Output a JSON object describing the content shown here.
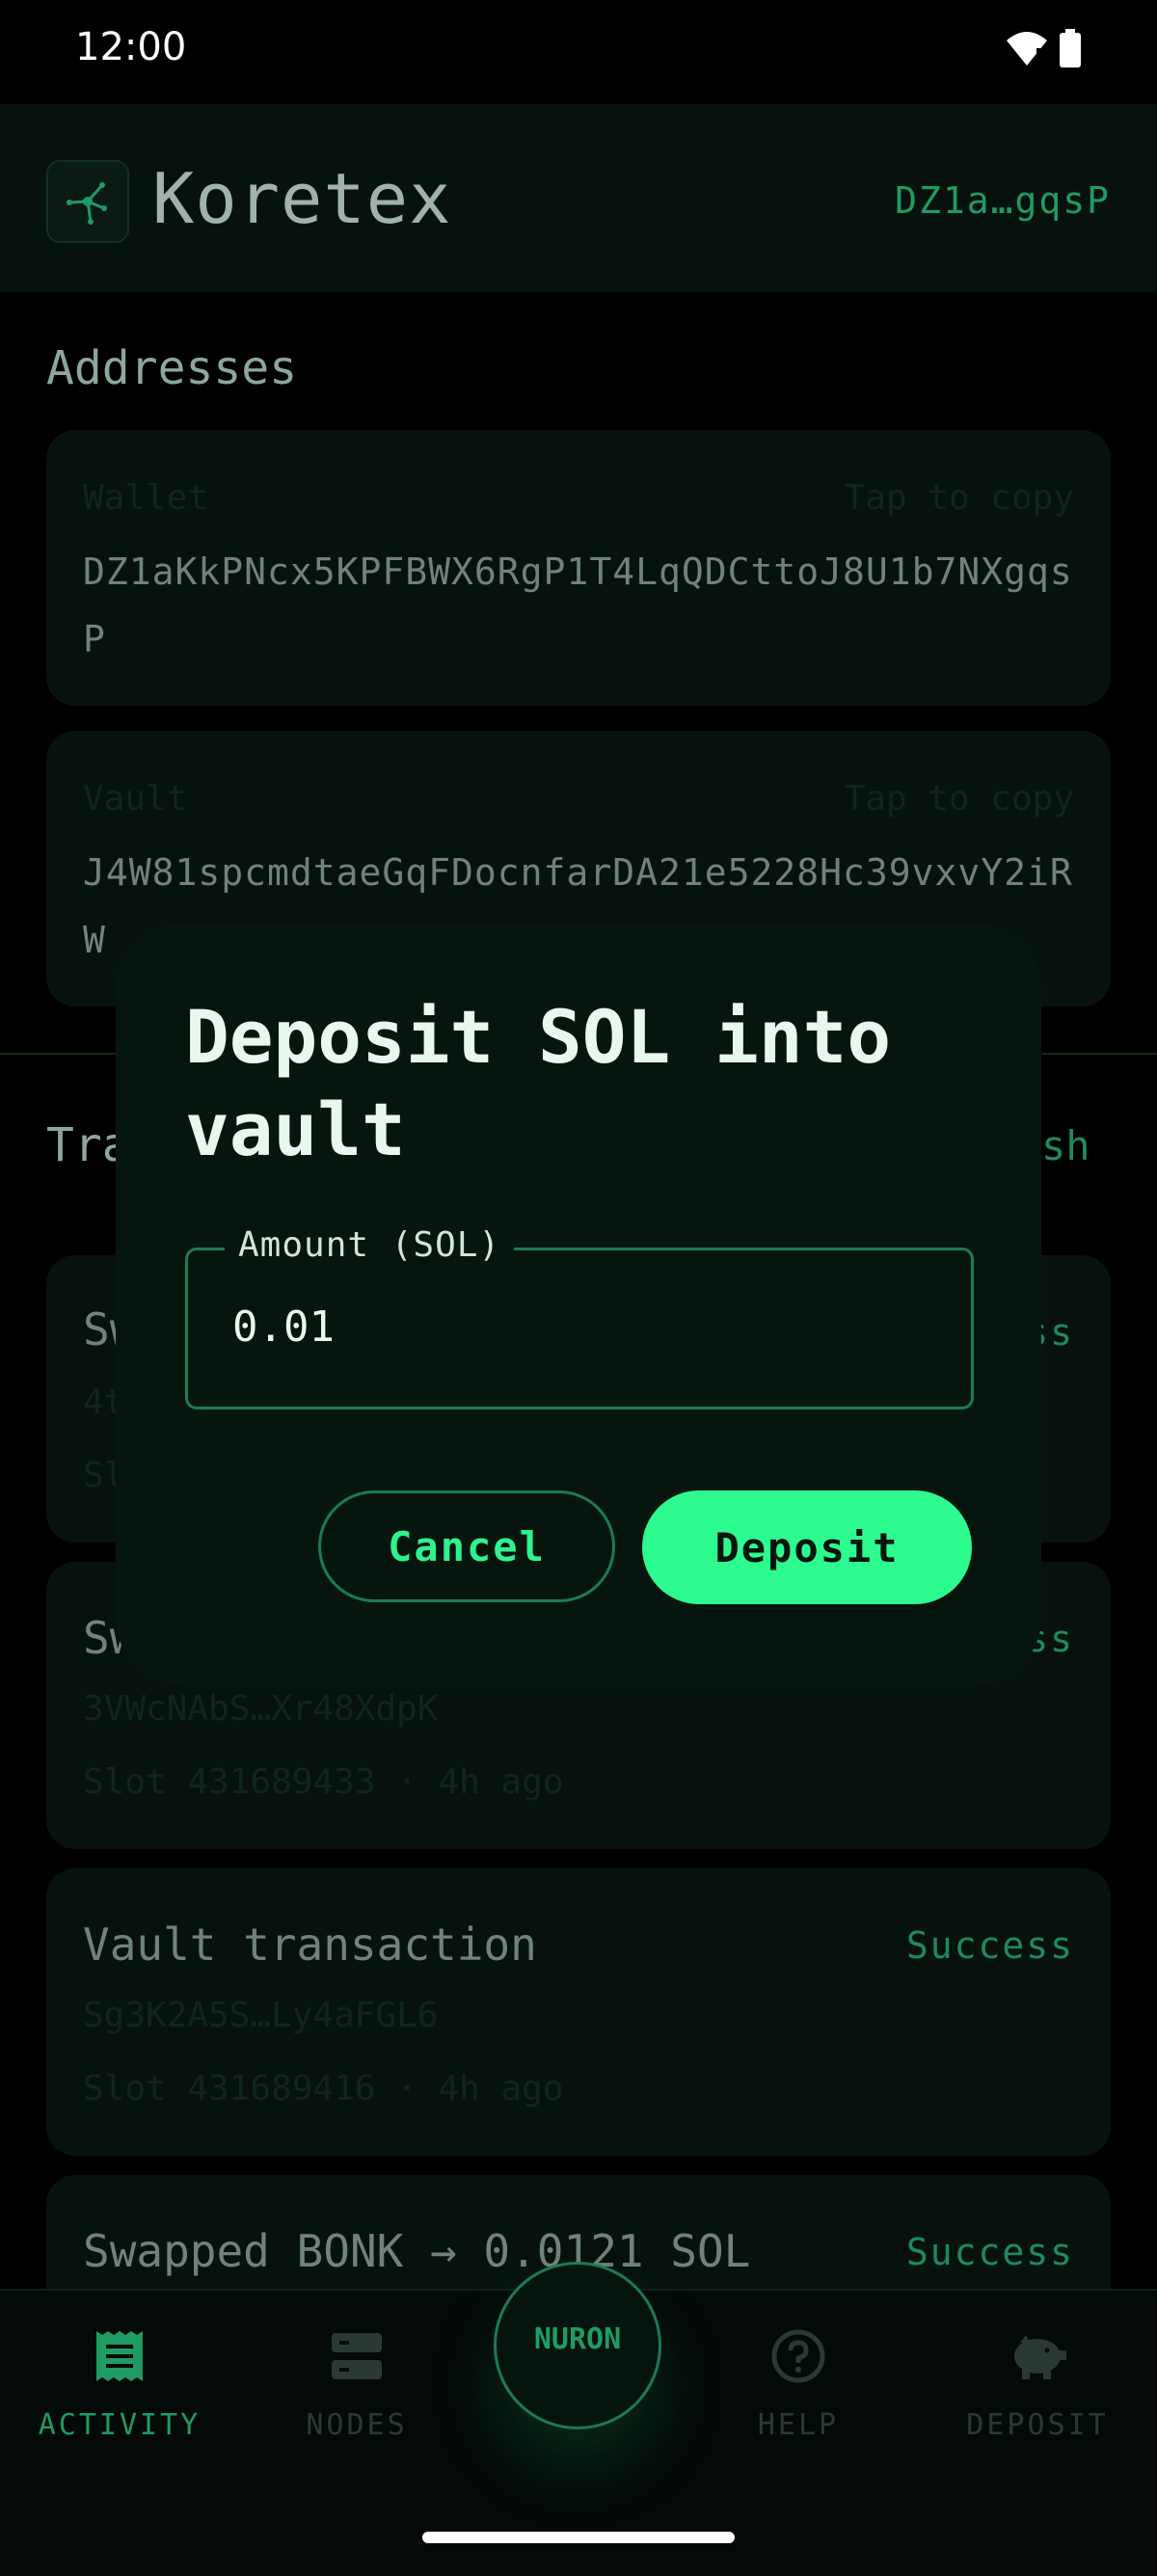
{
  "status_bar": {
    "time": "12:00"
  },
  "header": {
    "app_name": "Koretex",
    "short_address": "DZ1a…gqsP"
  },
  "addresses": {
    "section_title": "Addresses",
    "wallet": {
      "label": "Wallet",
      "hint": "Tap to copy",
      "value": "DZ1aKkPNcx5KPFBWX6RgP1T4LqQDCttoJ8U1b7NXgqsP"
    },
    "vault": {
      "label": "Vault",
      "hint": "Tap to copy",
      "value": "J4W81spcmdtaeGqFDocnfarDA21e5228Hc39vxvY2iRW"
    }
  },
  "transactions": {
    "section_title_partial": "Tra",
    "refresh_partial": "sh",
    "items": [
      {
        "title_partial": "Sw",
        "status_partial": "ss",
        "sig_partial": "4t",
        "meta_partial": "Sl"
      },
      {
        "title_partial": "Sw",
        "status_partial": "ss",
        "sig": "3VWcNAbS…Xr48XdpK",
        "meta": "Slot 431689433 · 4h ago"
      },
      {
        "title": "Vault transaction",
        "status": "Success",
        "sig": "Sg3K2A5S…Ly4aFGL6",
        "meta": "Slot 431689416 · 4h ago"
      },
      {
        "title": "Swapped BONK → 0.0121 SOL",
        "status": "Success"
      }
    ]
  },
  "dialog": {
    "title": "Deposit SOL into vault",
    "field_label": "Amount (SOL)",
    "field_value": "0.01",
    "cancel_label": "Cancel",
    "deposit_label": "Deposit"
  },
  "nav": {
    "activity": "ACTIVITY",
    "nodes": "NODES",
    "center": "NURON",
    "help": "HELP",
    "deposit": "DEPOSIT",
    "active_color": "#1f9b63",
    "inactive_color": "#2a3a33"
  }
}
